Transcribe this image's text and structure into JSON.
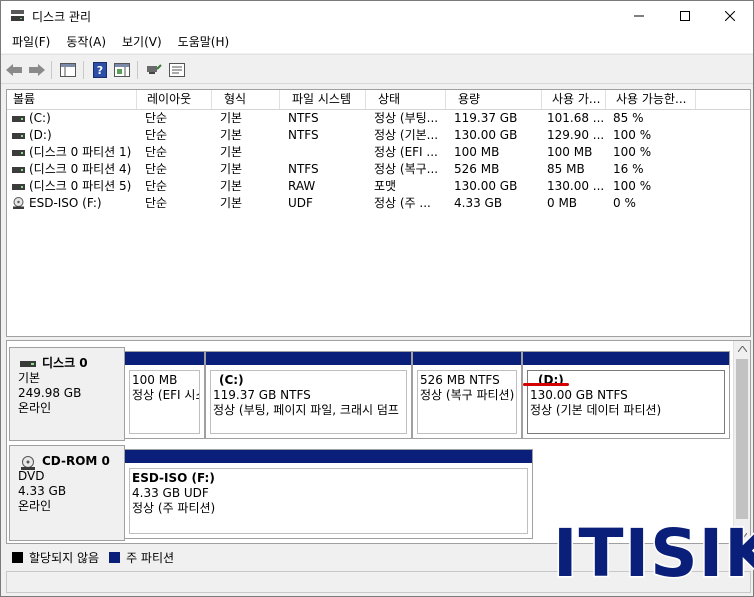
{
  "window": {
    "title": "디스크 관리"
  },
  "menu": [
    "파일(F)",
    "동작(A)",
    "보기(V)",
    "도움말(H)"
  ],
  "columns": [
    "볼륨",
    "레이아웃",
    "형식",
    "파일 시스템",
    "상태",
    "용량",
    "사용 가...",
    "사용 가능한..."
  ],
  "volumes": [
    {
      "icon": "drive-icon",
      "name": "(C:)",
      "layout": "단순",
      "type": "기본",
      "fs": "NTFS",
      "status": "정상 (부팅...",
      "capacity": "119.37 GB",
      "free": "101.68 ...",
      "pct": "85 %"
    },
    {
      "icon": "drive-icon",
      "name": "(D:)",
      "layout": "단순",
      "type": "기본",
      "fs": "NTFS",
      "status": "정상 (기본...",
      "capacity": "130.00 GB",
      "free": "129.90 ...",
      "pct": "100 %"
    },
    {
      "icon": "drive-icon",
      "name": "(디스크 0 파티션 1)",
      "layout": "단순",
      "type": "기본",
      "fs": "",
      "status": "정상 (EFI ...",
      "capacity": "100 MB",
      "free": "100 MB",
      "pct": "100 %"
    },
    {
      "icon": "drive-icon",
      "name": "(디스크 0 파티션 4)",
      "layout": "단순",
      "type": "기본",
      "fs": "NTFS",
      "status": "정상 (복구...",
      "capacity": "526 MB",
      "free": "85 MB",
      "pct": "16 %"
    },
    {
      "icon": "drive-icon",
      "name": "(디스크 0 파티션 5)",
      "layout": "단순",
      "type": "기본",
      "fs": "RAW",
      "status": "포맷",
      "capacity": "130.00 GB",
      "free": "130.00 ...",
      "pct": "100 %"
    },
    {
      "icon": "cdrom-icon",
      "name": "ESD-ISO (F:)",
      "layout": "단순",
      "type": "기본",
      "fs": "UDF",
      "status": "정상 (주 ...",
      "capacity": "4.33 GB",
      "free": "0 MB",
      "pct": "0 %"
    }
  ],
  "disks": [
    {
      "name": "디스크 0",
      "type": "기본",
      "size": "249.98 GB",
      "state": "온라인",
      "partitions": [
        {
          "name": "",
          "size": "100 MB",
          "status": "정상 (EFI 시스"
        },
        {
          "name": "(C:)",
          "size": "119.37 GB NTFS",
          "status": "정상 (부팅, 페이지 파일, 크래시 덤프"
        },
        {
          "name": "",
          "size": "526 MB NTFS",
          "status": "정상 (복구 파티션)"
        },
        {
          "name": "(D:)",
          "size": "130.00 GB NTFS",
          "status": "정상 (기본 데이터 파티션)"
        }
      ]
    },
    {
      "name": "CD-ROM 0",
      "type": "DVD",
      "size": "4.33 GB",
      "state": "온라인",
      "partitions": [
        {
          "name": "ESD-ISO  (F:)",
          "size": "4.33 GB UDF",
          "status": "정상 (주 파티션)"
        }
      ]
    }
  ],
  "legend": [
    {
      "label": "할당되지 않음",
      "color": "#000000"
    },
    {
      "label": "주 파티션",
      "color": "#0a1f7a"
    }
  ],
  "watermark": "ITISIK"
}
